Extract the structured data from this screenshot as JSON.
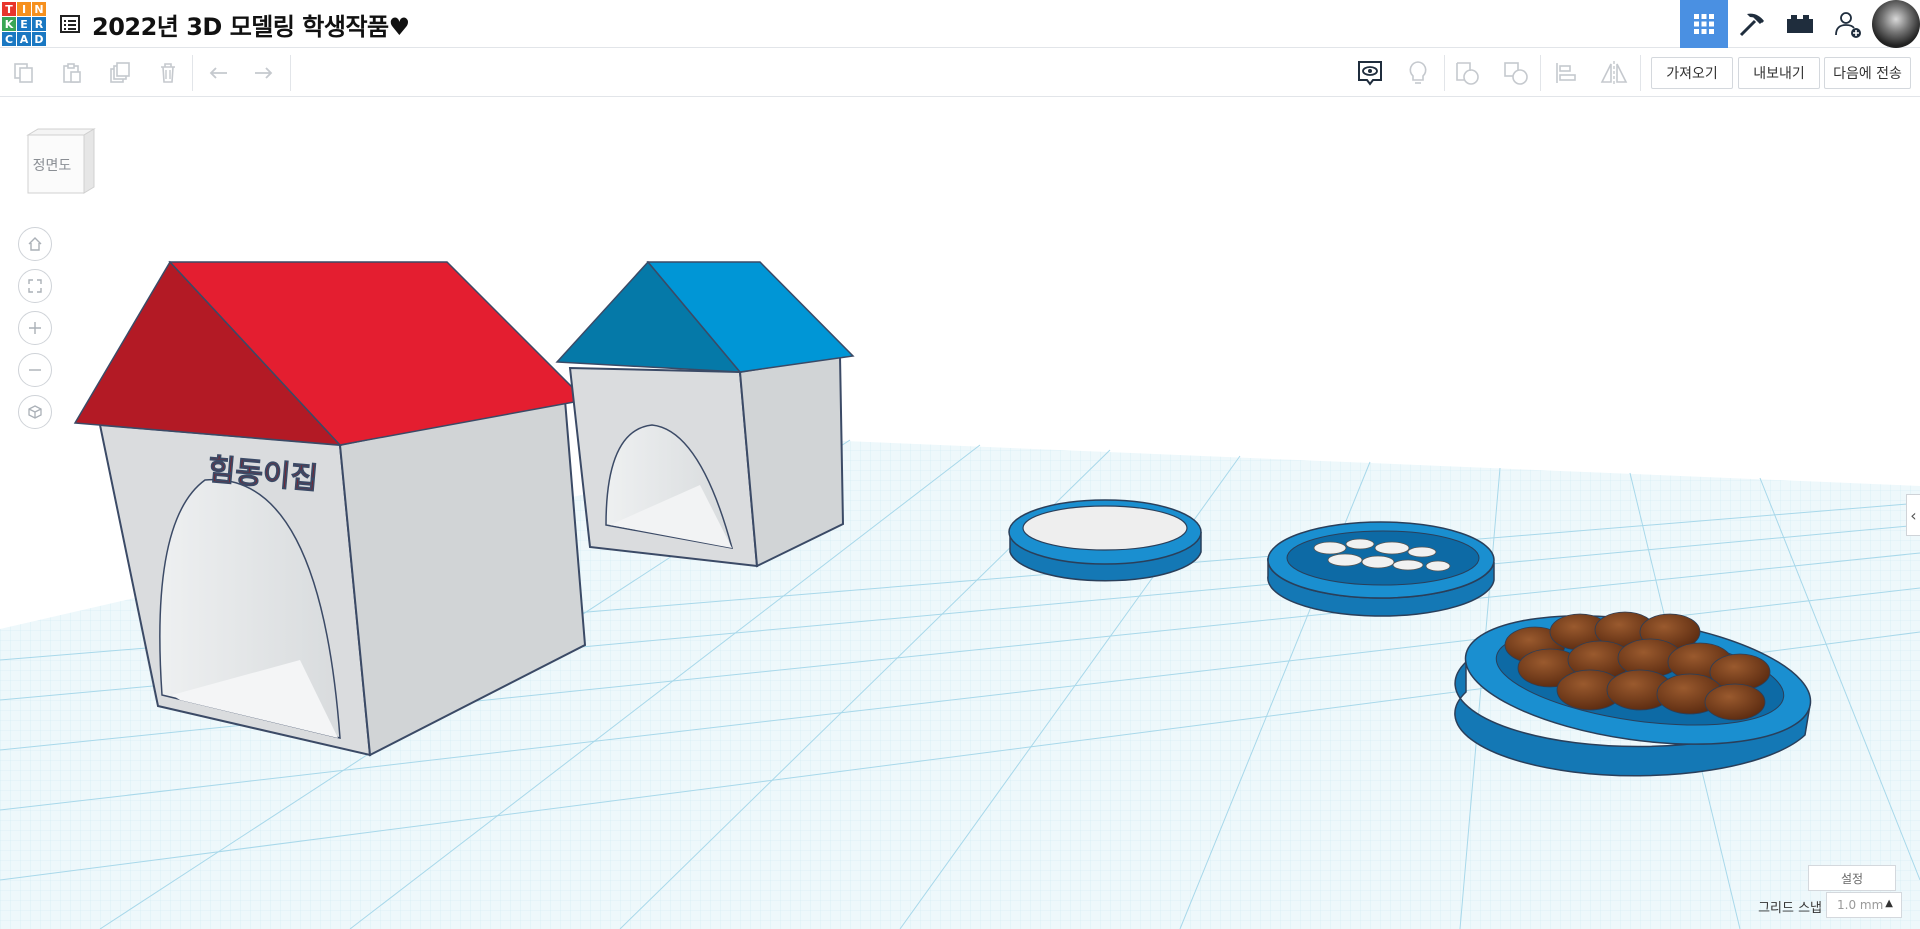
{
  "app": {
    "logo_letters": [
      "T",
      "I",
      "N",
      "K",
      "E",
      "R",
      "C",
      "A",
      "D"
    ],
    "logo_colors": [
      "#e8352c",
      "#f6901e",
      "#f6901e",
      "#3aa655",
      "#1a78c2",
      "#1a78c2",
      "#1a78c2",
      "#1a78c2",
      "#1a78c2"
    ],
    "title": "2022년 3D 모델링 학생작품♥"
  },
  "header": {
    "buttons": [
      {
        "name": "3d-design-view",
        "icon": "grid-icon",
        "active": true
      },
      {
        "name": "codeblocks",
        "icon": "pickaxe-icon",
        "active": false
      },
      {
        "name": "bricks-view",
        "icon": "brick-icon",
        "active": false
      },
      {
        "name": "add-user",
        "icon": "add-user-icon",
        "active": false
      }
    ]
  },
  "toolbar": {
    "left_tools": [
      "copy-icon",
      "paste-icon",
      "duplicate-icon",
      "delete-icon",
      "undo-icon",
      "redo-icon"
    ],
    "right_tools": [
      "show-icon",
      "light-icon",
      "group-icon",
      "ungroup-icon",
      "align-icon",
      "mirror-icon"
    ],
    "import_label": "가져오기",
    "export_label": "내보내기",
    "send_label": "다음에 전송"
  },
  "viewport": {
    "viewcube_label": "정면도",
    "nav": [
      "home-icon",
      "fit-icon",
      "zoom-in-icon",
      "zoom-out-icon",
      "perspective-icon"
    ],
    "doghouse_sign": "힘동이집",
    "settings_label": "설정",
    "grid_snap_label": "그리드 스냅",
    "grid_snap_value": "1.0 mm",
    "colors": {
      "roof_red": "#e41e30",
      "roof_blue": "#0096d6",
      "bowl_blue": "#1478b5",
      "grid_line": "#9fd6e8",
      "walls": "#dadcde"
    }
  }
}
